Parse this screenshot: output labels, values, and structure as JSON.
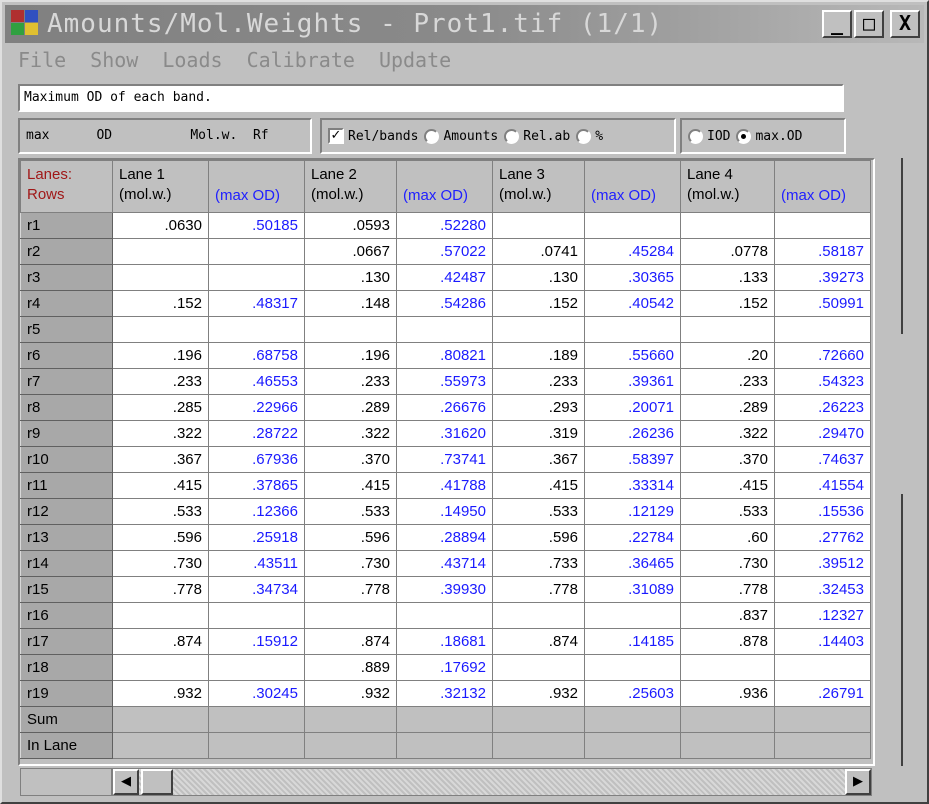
{
  "window": {
    "title": "Amounts/Mol.Weights - Prot1.tif (1/1)",
    "controls": {
      "minimize": "_",
      "maximize": "□",
      "close": "X"
    }
  },
  "menu": [
    "File",
    "Show",
    "Loads",
    "Calibrate",
    "Update"
  ],
  "status_text": "Maximum OD of each band.",
  "info_box": "max      OD          Mol.w.  Rf",
  "options": {
    "rel_bands": {
      "label": "Rel/bands",
      "checked": true
    },
    "amounts": {
      "label": "Amounts",
      "selected": false
    },
    "rel_ab": {
      "label": "Rel.ab",
      "selected": false
    },
    "percent": {
      "label": "%",
      "selected": false
    },
    "iod": {
      "label": "IOD",
      "selected": false
    },
    "max_od": {
      "label": "max.OD",
      "selected": true
    }
  },
  "table": {
    "corner": [
      "Lanes:",
      "Rows"
    ],
    "lanes": [
      {
        "name": "Lane 1",
        "sub1": "(mol.w.)",
        "sub2": "(max OD)"
      },
      {
        "name": "Lane 2",
        "sub1": "(mol.w.)",
        "sub2": "(max OD)"
      },
      {
        "name": "Lane 3",
        "sub1": "(mol.w.)",
        "sub2": "(max OD)"
      },
      {
        "name": "Lane 4",
        "sub1": "(mol.w.)",
        "sub2": "(max OD)"
      }
    ],
    "rows": [
      {
        "label": "r1",
        "cells": [
          ".0630",
          ".50185",
          ".0593",
          ".52280",
          "",
          "",
          "",
          ""
        ]
      },
      {
        "label": "r2",
        "cells": [
          "",
          "",
          ".0667",
          ".57022",
          ".0741",
          ".45284",
          ".0778",
          ".58187"
        ]
      },
      {
        "label": "r3",
        "cells": [
          "",
          "",
          ".130",
          ".42487",
          ".130",
          ".30365",
          ".133",
          ".39273"
        ]
      },
      {
        "label": "r4",
        "cells": [
          ".152",
          ".48317",
          ".148",
          ".54286",
          ".152",
          ".40542",
          ".152",
          ".50991"
        ]
      },
      {
        "label": "r5",
        "cells": [
          "",
          "",
          "",
          "",
          "",
          "",
          "",
          ""
        ]
      },
      {
        "label": "r6",
        "cells": [
          ".196",
          ".68758",
          ".196",
          ".80821",
          ".189",
          ".55660",
          ".20",
          ".72660"
        ]
      },
      {
        "label": "r7",
        "cells": [
          ".233",
          ".46553",
          ".233",
          ".55973",
          ".233",
          ".39361",
          ".233",
          ".54323"
        ]
      },
      {
        "label": "r8",
        "cells": [
          ".285",
          ".22966",
          ".289",
          ".26676",
          ".293",
          ".20071",
          ".289",
          ".26223"
        ]
      },
      {
        "label": "r9",
        "cells": [
          ".322",
          ".28722",
          ".322",
          ".31620",
          ".319",
          ".26236",
          ".322",
          ".29470"
        ]
      },
      {
        "label": "r10",
        "cells": [
          ".367",
          ".67936",
          ".370",
          ".73741",
          ".367",
          ".58397",
          ".370",
          ".74637"
        ]
      },
      {
        "label": "r11",
        "cells": [
          ".415",
          ".37865",
          ".415",
          ".41788",
          ".415",
          ".33314",
          ".415",
          ".41554"
        ]
      },
      {
        "label": "r12",
        "cells": [
          ".533",
          ".12366",
          ".533",
          ".14950",
          ".533",
          ".12129",
          ".533",
          ".15536"
        ]
      },
      {
        "label": "r13",
        "cells": [
          ".596",
          ".25918",
          ".596",
          ".28894",
          ".596",
          ".22784",
          ".60",
          ".27762"
        ]
      },
      {
        "label": "r14",
        "cells": [
          ".730",
          ".43511",
          ".730",
          ".43714",
          ".733",
          ".36465",
          ".730",
          ".39512"
        ]
      },
      {
        "label": "r15",
        "cells": [
          ".778",
          ".34734",
          ".778",
          ".39930",
          ".778",
          ".31089",
          ".778",
          ".32453"
        ]
      },
      {
        "label": "r16",
        "cells": [
          "",
          "",
          "",
          "",
          "",
          "",
          ".837",
          ".12327"
        ]
      },
      {
        "label": "r17",
        "cells": [
          ".874",
          ".15912",
          ".874",
          ".18681",
          ".874",
          ".14185",
          ".878",
          ".14403"
        ]
      },
      {
        "label": "r18",
        "cells": [
          "",
          "",
          ".889",
          ".17692",
          "",
          "",
          "",
          ""
        ]
      },
      {
        "label": "r19",
        "cells": [
          ".932",
          ".30245",
          ".932",
          ".32132",
          ".932",
          ".25603",
          ".936",
          ".26791"
        ]
      }
    ],
    "footer_rows": [
      "Sum",
      "In Lane"
    ]
  },
  "scrollbar": {
    "left_arrow": "◀",
    "right_arrow": "▶"
  },
  "colors": {
    "od_text": "#1a1aff",
    "corner_text": "#a01818",
    "title_gradient_start": "#808080"
  }
}
